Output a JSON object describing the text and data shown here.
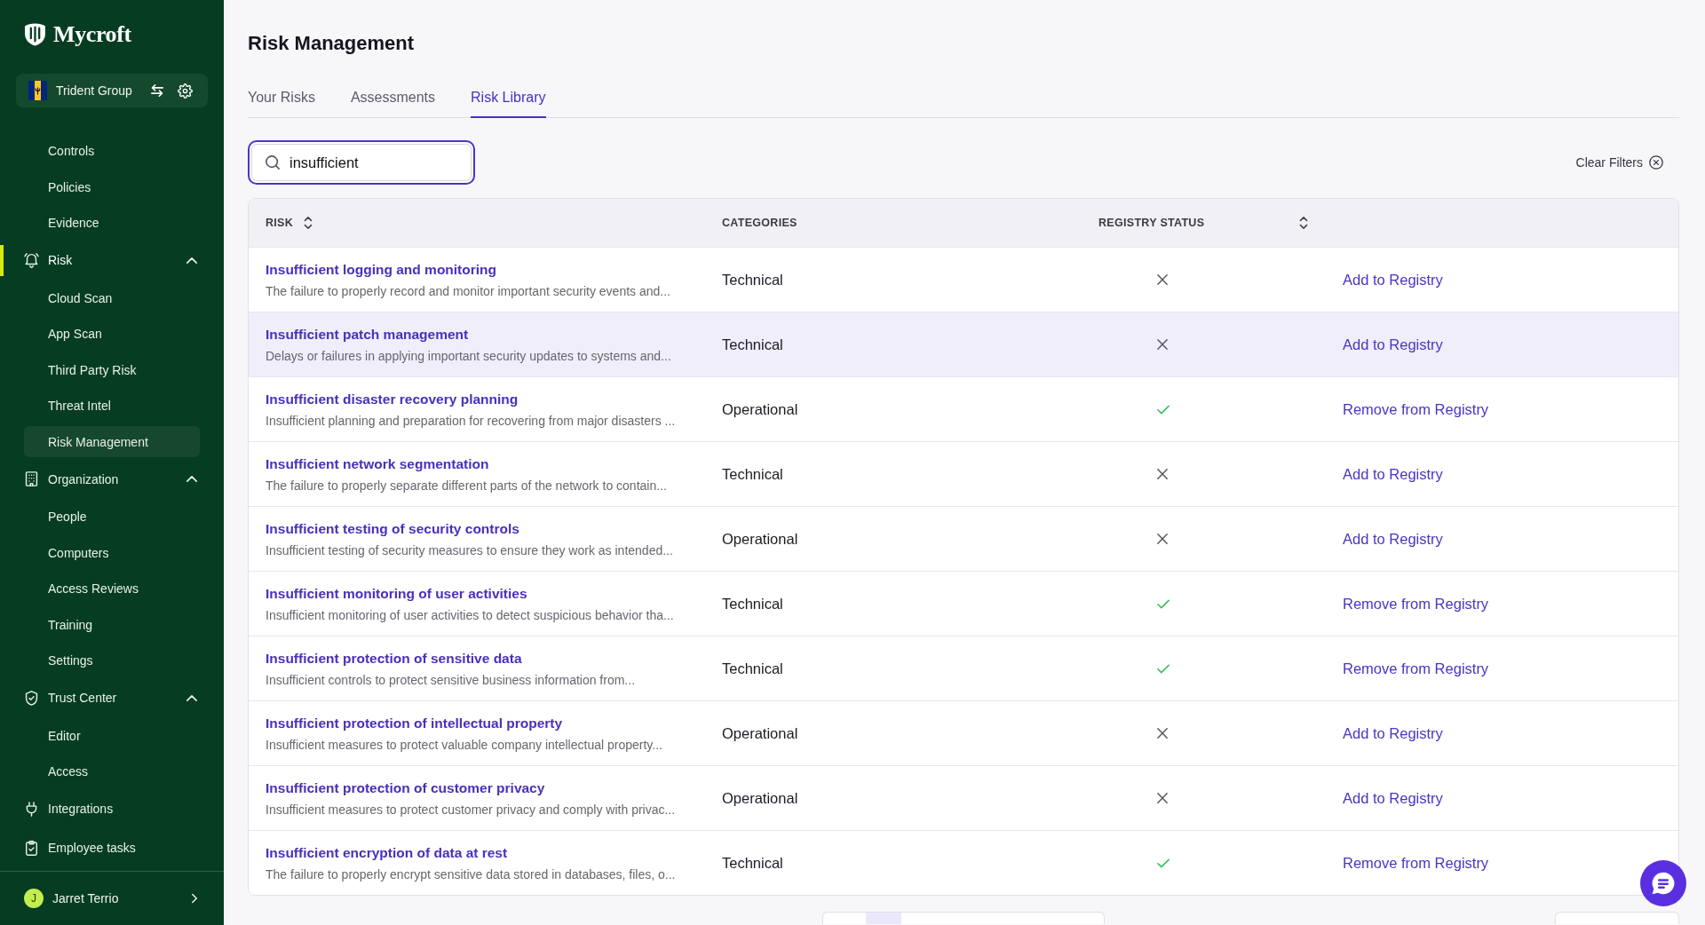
{
  "sidebar": {
    "logo": "Mycroft",
    "organization": "Trident Group",
    "items": [
      {
        "kind": "group",
        "children": [
          {
            "label": "Controls",
            "selected": false
          },
          {
            "label": "Policies",
            "selected": false
          },
          {
            "label": "Evidence",
            "selected": false
          }
        ]
      },
      {
        "kind": "section",
        "label": "Risk",
        "selected": true,
        "expanded": true,
        "children": [
          {
            "label": "Cloud Scan",
            "selected": false
          },
          {
            "label": "App Scan",
            "selected": false
          },
          {
            "label": "Third Party Risk",
            "selected": false
          },
          {
            "label": "Threat Intel",
            "selected": false
          },
          {
            "label": "Risk Management",
            "selected": true
          }
        ]
      },
      {
        "kind": "section",
        "label": "Organization",
        "selected": false,
        "expanded": true,
        "children": [
          {
            "label": "People",
            "selected": false
          },
          {
            "label": "Computers",
            "selected": false
          },
          {
            "label": "Access Reviews",
            "selected": false
          },
          {
            "label": "Training",
            "selected": false
          },
          {
            "label": "Settings",
            "selected": false
          }
        ]
      },
      {
        "kind": "section",
        "label": "Trust Center",
        "selected": false,
        "expanded": true,
        "children": [
          {
            "label": "Editor",
            "selected": false
          },
          {
            "label": "Access",
            "selected": false
          }
        ]
      },
      {
        "kind": "link",
        "label": "Integrations",
        "selected": false
      },
      {
        "kind": "link",
        "label": "Employee tasks",
        "selected": false
      }
    ],
    "user": {
      "initial": "J",
      "name": "Jarret Terrio"
    }
  },
  "page": {
    "title": "Risk Management"
  },
  "tabs": [
    {
      "label": "Your Risks",
      "selected": false
    },
    {
      "label": "Assessments",
      "selected": false
    },
    {
      "label": "Risk Library",
      "selected": true
    }
  ],
  "search": {
    "value": "insufficient",
    "focused": true
  },
  "clear_filters": {
    "label": "Clear Filters"
  },
  "table": {
    "columns": [
      {
        "label": "RISK",
        "sortable": true
      },
      {
        "label": "CATEGORIES",
        "sortable": false
      },
      {
        "label": "REGISTRY STATUS",
        "sortable": true
      }
    ],
    "rows": [
      {
        "title": "Insufficient logging and monitoring",
        "description": "The failure to properly record and monitor important security events and...",
        "category": "Technical",
        "registered": false,
        "action": "Add to Registry",
        "hovered": false
      },
      {
        "title": "Insufficient patch management",
        "description": "Delays or failures in applying important security updates to systems and...",
        "category": "Technical",
        "registered": false,
        "action": "Add to Registry",
        "hovered": true
      },
      {
        "title": "Insufficient disaster recovery planning",
        "description": "Insufficient planning and preparation for recovering from major disasters ...",
        "category": "Operational",
        "registered": true,
        "action": "Remove from Registry",
        "hovered": false
      },
      {
        "title": "Insufficient network segmentation",
        "description": "The failure to properly separate different parts of the network to contain...",
        "category": "Technical",
        "registered": false,
        "action": "Add to Registry",
        "hovered": false
      },
      {
        "title": "Insufficient testing of security controls",
        "description": "Insufficient testing of security measures to ensure they work as intended...",
        "category": "Operational",
        "registered": false,
        "action": "Add to Registry",
        "hovered": false
      },
      {
        "title": "Insufficient monitoring of user activities",
        "description": "Insufficient monitoring of user activities to detect suspicious behavior tha...",
        "category": "Technical",
        "registered": true,
        "action": "Remove from Registry",
        "hovered": false
      },
      {
        "title": "Insufficient protection of sensitive data",
        "description": "Insufficient controls to protect sensitive business information from...",
        "category": "Technical",
        "registered": true,
        "action": "Remove from Registry",
        "hovered": false
      },
      {
        "title": "Insufficient protection of intellectual property",
        "description": "Insufficient measures to protect valuable company intellectual property...",
        "category": "Operational",
        "registered": false,
        "action": "Add to Registry",
        "hovered": false
      },
      {
        "title": "Insufficient protection of customer privacy",
        "description": "Insufficient measures to protect customer privacy and comply with privac...",
        "category": "Operational",
        "registered": false,
        "action": "Add to Registry",
        "hovered": false
      },
      {
        "title": "Insufficient encryption of data at rest",
        "description": "The failure to properly encrypt sensitive data stored in databases, files, o...",
        "category": "Technical",
        "registered": true,
        "action": "Remove from Registry",
        "hovered": false
      }
    ]
  }
}
